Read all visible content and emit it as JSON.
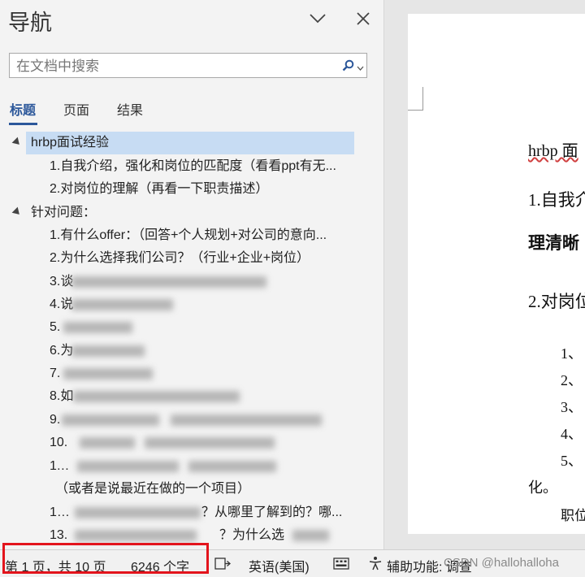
{
  "nav": {
    "title": "导航",
    "search_placeholder": "在文档中搜索",
    "tabs": [
      {
        "label": "标题"
      },
      {
        "label": "页面"
      },
      {
        "label": "结果"
      }
    ],
    "headings": [
      {
        "text": "hrbp面试经验"
      },
      {
        "text": "1.自我介绍，强化和岗位的匹配度（看看ppt有无..."
      },
      {
        "text": "2.对岗位的理解（再看一下职责描述）"
      },
      {
        "text": "针对问题："
      },
      {
        "text": "1.有什么offer：（回答+个人规划+对公司的意向..."
      },
      {
        "text": "2.为什么选择我们公司？（行业+企业+岗位）"
      },
      {
        "text": "3.谈"
      },
      {
        "text": "4.说"
      },
      {
        "text": "5."
      },
      {
        "text": "6.为"
      },
      {
        "text": "7."
      },
      {
        "text": "8.如"
      },
      {
        "text": "9."
      },
      {
        "text": "10."
      },
      {
        "text": "11.遇"
      },
      {
        "text": "（或者是说最近在做的一个项目）"
      },
      {
        "text": "12.你"
      },
      {
        "text": "13."
      }
    ],
    "row12_tail": "？从哪里了解到的？哪...",
    "row13_tail": "？为什么选"
  },
  "document": {
    "line1": "hrbp 面",
    "line2": "1.自我介",
    "line3": "理清晰",
    "line4": "2.对岗位",
    "list": [
      "1、",
      "2、",
      "3、",
      "4、",
      "5、"
    ],
    "line5": "化。",
    "line6": "职位"
  },
  "status": {
    "page_info": "第 1 页，共 10 页",
    "word_count": "6246 个字",
    "language": "英语(美国)",
    "accessibility": "辅助功能: 调查"
  },
  "watermark": "CSDN @hallohalloha",
  "colors": {
    "accent": "#2b579a",
    "selection": "#c7dcf3",
    "highlight_box": "#e3141c"
  }
}
